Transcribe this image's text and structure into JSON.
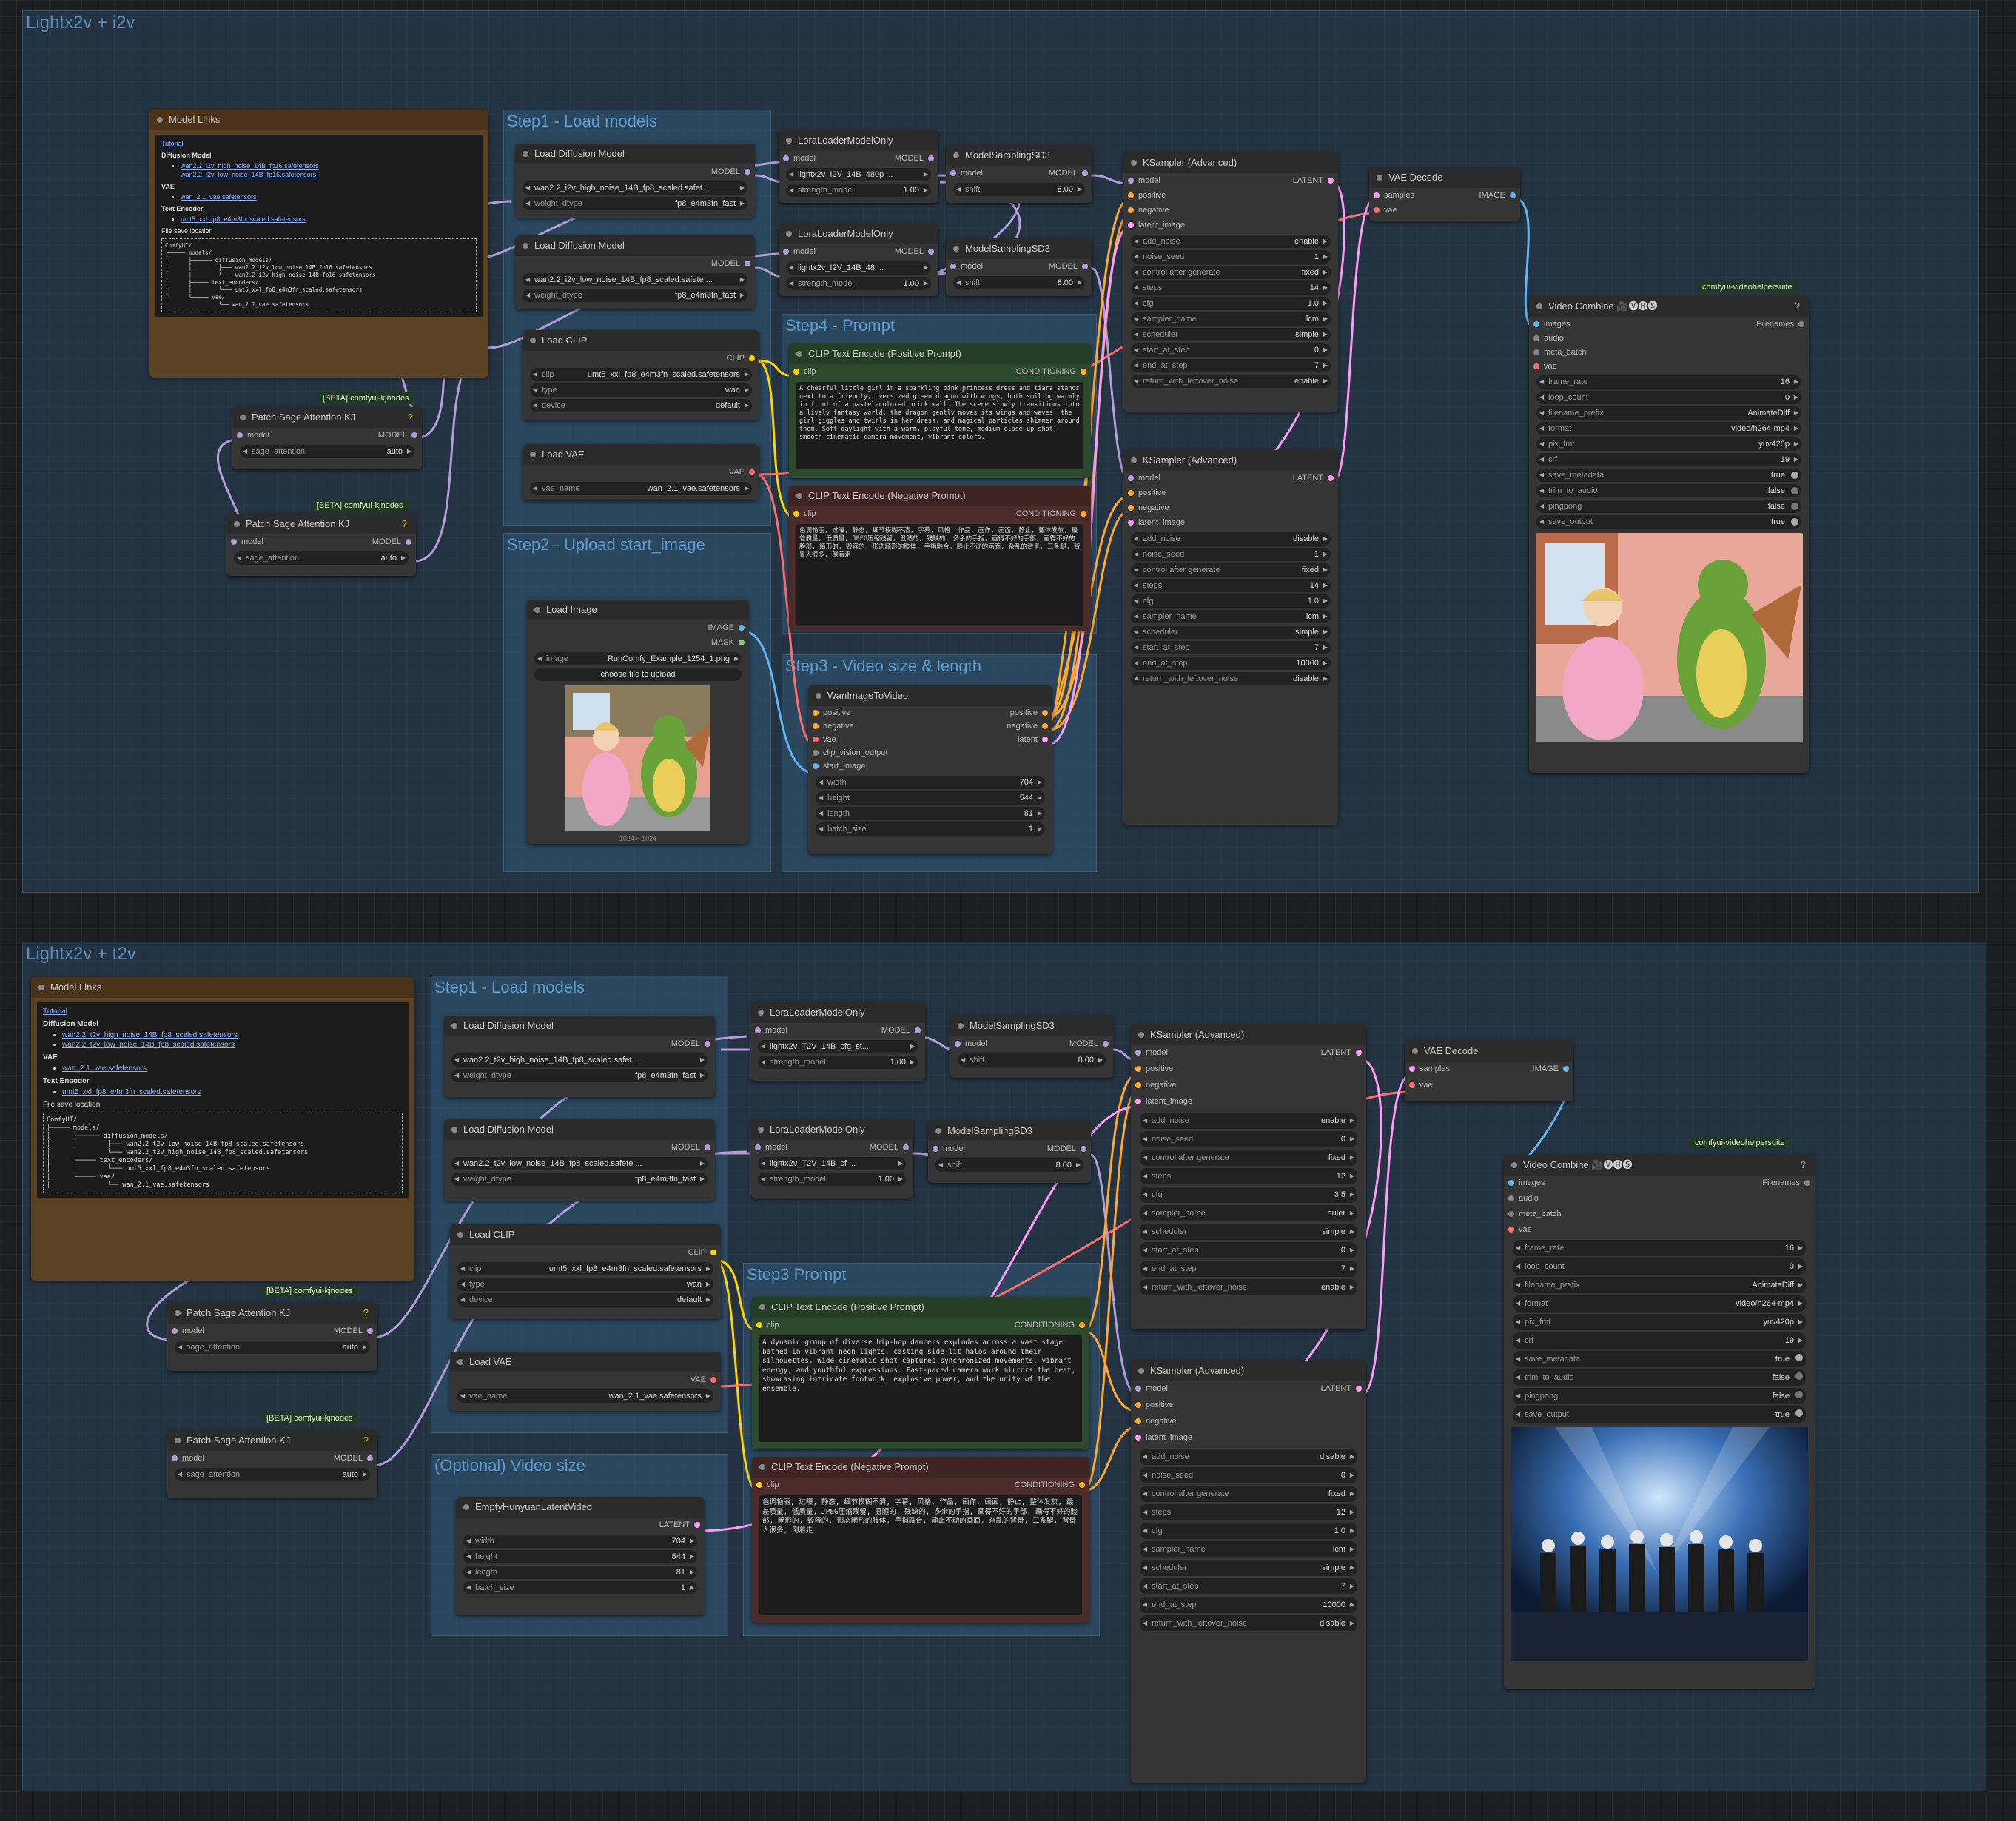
{
  "colors": {
    "model": "#b39ddb",
    "clip": "#ffd500",
    "vae": "#ff6e6e",
    "conditioning": "#ffa931",
    "latent": "#ff9cf9",
    "image": "#64b5f6",
    "mask": "#81c784"
  },
  "top": {
    "group_title": "Lightx2v + i2v",
    "step1": "Step1 - Load models",
    "step2": "Step2 - Upload start_image",
    "step3": "Step3 - Video size & length",
    "step4": "Step4 - Prompt",
    "links": {
      "title": "Model Links",
      "tutorial": "Tutorial",
      "diffusion_h": "Diffusion Model",
      "d1": "wan2.2_i2v_high_noise_14B_fp16.safetensors",
      "d2": "wan2.2_i2v_low_noise_14B_fp16.safetensors",
      "vae_h": "VAE",
      "v1": "wan_2.1_vae.safetensors",
      "te_h": "Text Encoder",
      "t1": "umt5_xxl_fp8_e4m3fn_scaled.safetensors",
      "save_h": "File save location",
      "tree": "ComfyUI/\n├───── models/\n│      ├────── diffusion_models/\n│      │        ├─── wan2.2_i2v_low_noise_14B_fp16.safetensors\n│      │        └─── wan2.2_i2v_high_noise_14B_fp16.safetensors\n│      ├───── text_encoders/\n│      │        └─── umt5_xxl_fp8_e4m3fn_scaled.safetensors\n│      └───── vae/\n│               └── wan_2.1_vae.safetensors"
    },
    "sage1": {
      "badge": "[BETA] comfyui-kjnodes",
      "title": "Patch Sage Attention KJ",
      "in": "model",
      "out": "MODEL",
      "w": "sage_attention",
      "v": "auto"
    },
    "sage2": {
      "badge": "[BETA] comfyui-kjnodes",
      "title": "Patch Sage Attention KJ",
      "in": "model",
      "out": "MODEL",
      "w": "sage_attention",
      "v": "auto"
    },
    "ldm1": {
      "title": "Load Diffusion Model",
      "out": "MODEL",
      "w1": "wan2.2_i2v_high_noise_14B_fp8_scaled.safet ...",
      "w2l": "weight_dtype",
      "w2v": "fp8_e4m3fn_fast"
    },
    "ldm2": {
      "title": "Load Diffusion Model",
      "out": "MODEL",
      "w1": "wan2.2_i2v_low_noise_14B_fp8_scaled.safete ...",
      "w2l": "weight_dtype",
      "w2v": "fp8_e4m3fn_fast"
    },
    "clip": {
      "title": "Load CLIP",
      "out": "CLIP",
      "w1l": "clip",
      "w1v": "umt5_xxl_fp8_e4m3fn_scaled.safetensors",
      "w2l": "type",
      "w2v": "wan",
      "w3l": "device",
      "w3v": "default"
    },
    "vae": {
      "title": "Load VAE",
      "out": "VAE",
      "wl": "vae_name",
      "wv": "wan_2.1_vae.safetensors"
    },
    "img": {
      "title": "Load Image",
      "o1": "IMAGE",
      "o2": "MASK",
      "wl": "image",
      "wv": "RunComfy_Example_1254_1.png",
      "btn": "choose file to upload",
      "cap": "1024 × 1024"
    },
    "lora1": {
      "title": "LoraLoaderModelOnly",
      "in": "model",
      "out": "MODEL",
      "w1": "lightx2v_I2V_14B_480p ...",
      "w2l": "strength_model",
      "w2v": "1.00"
    },
    "lora2": {
      "title": "LoraLoaderModelOnly",
      "in": "model",
      "out": "MODEL",
      "w1": "lightx2v_I2V_14B_48 ...",
      "w2l": "strength_model",
      "w2v": "1.00"
    },
    "ms1": {
      "title": "ModelSamplingSD3",
      "in": "model",
      "out": "MODEL",
      "wl": "shift",
      "wv": "8.00"
    },
    "ms2": {
      "title": "ModelSamplingSD3",
      "in": "model",
      "out": "MODEL",
      "wl": "shift",
      "wv": "8.00"
    },
    "pos": {
      "title": "CLIP Text Encode (Positive Prompt)",
      "in": "clip",
      "out": "CONDITIONING",
      "text": "A cheerful little girl in a sparkling pink princess dress and tiara stands next to a friendly, oversized green dragon with wings, both smiling warmly in front of a pastel-colored brick wall. The scene slowly transitions into a lively fantasy world: the dragon gently moves its wings and waves, the girl giggles and twirls in her dress, and magical particles shimmer around them. Soft daylight with a warm, playful tone, medium close-up shot, smooth cinematic camera movement, vibrant colors."
    },
    "neg": {
      "title": "CLIP Text Encode (Negative Prompt)",
      "in": "clip",
      "out": "CONDITIONING",
      "text": "色调艳丽, 过曝, 静态, 细节模糊不清, 字幕, 风格, 作品, 画作, 画面, 静止, 整体发灰, 最差质量, 低质量, JPEG压缩残留, 丑陋的, 残缺的, 多余的手指, 画得不好的手部, 画得不好的脸部, 畸形的, 毁容的, 形态畸形的肢体, 手指融合, 静止不动的画面, 杂乱的背景, 三条腿, 背景人很多, 倒着走"
    },
    "wan": {
      "title": "WanImageToVideo",
      "i1": "positive",
      "i2": "negative",
      "i3": "vae",
      "i4": "clip_vision_output",
      "i5": "start_image",
      "o1": "positive",
      "o2": "negative",
      "o3": "latent",
      "w": [
        [
          "width",
          "704"
        ],
        [
          "height",
          "544"
        ],
        [
          "length",
          "81"
        ],
        [
          "batch_size",
          "1"
        ]
      ]
    },
    "ks1": {
      "title": "KSampler (Advanced)",
      "ins": [
        "model",
        "positive",
        "negative",
        "latent_image"
      ],
      "out": "LATENT",
      "w": [
        [
          "add_noise",
          "enable"
        ],
        [
          "noise_seed",
          "1"
        ],
        [
          "control after generate",
          "fixed"
        ],
        [
          "steps",
          "14"
        ],
        [
          "cfg",
          "1.0"
        ],
        [
          "sampler_name",
          "lcm"
        ],
        [
          "scheduler",
          "simple"
        ],
        [
          "start_at_step",
          "0"
        ],
        [
          "end_at_step",
          "7"
        ],
        [
          "return_with_leftover_noise",
          "enable"
        ]
      ]
    },
    "ks2": {
      "title": "KSampler (Advanced)",
      "ins": [
        "model",
        "positive",
        "negative",
        "latent_image"
      ],
      "out": "LATENT",
      "w": [
        [
          "add_noise",
          "disable"
        ],
        [
          "noise_seed",
          "1"
        ],
        [
          "control after generate",
          "fixed"
        ],
        [
          "steps",
          "14"
        ],
        [
          "cfg",
          "1.0"
        ],
        [
          "sampler_name",
          "lcm"
        ],
        [
          "scheduler",
          "simple"
        ],
        [
          "start_at_step",
          "7"
        ],
        [
          "end_at_step",
          "10000"
        ],
        [
          "return_with_leftover_noise",
          "disable"
        ]
      ]
    },
    "vaed": {
      "title": "VAE Decode",
      "i1": "samples",
      "i2": "vae",
      "out": "IMAGE"
    },
    "vc": {
      "badge": "comfyui-videohelpersuite",
      "title": "Video Combine 🎥🅥🅗🅢",
      "ins": [
        "images",
        "audio",
        "meta_batch",
        "vae"
      ],
      "out": "Filenames",
      "w": [
        [
          "frame_rate",
          "16"
        ],
        [
          "loop_count",
          "0"
        ],
        [
          "filename_prefix",
          "AnimateDiff"
        ],
        [
          "format",
          "video/h264-mp4"
        ],
        [
          "pix_fmt",
          "yuv420p"
        ],
        [
          "crf",
          "19"
        ]
      ],
      "t": [
        [
          "save_metadata",
          "true"
        ],
        [
          "trim_to_audio",
          "false"
        ],
        [
          "pingpong",
          "false"
        ],
        [
          "save_output",
          "true"
        ]
      ]
    }
  },
  "bottom": {
    "group_title": "Lightx2v + t2v",
    "step1": "Step1 - Load models",
    "step3": "Step3 Prompt",
    "opt": "(Optional) Video size",
    "links": {
      "title": "Model Links",
      "tutorial": "Tutorial",
      "diffusion_h": "Diffusion Model",
      "d1": "wan2.2_t2v_high_noise_14B_fp8_scaled.safetensors",
      "d2": "wan2.2_t2v_low_noise_14B_fp8_scaled.safetensors",
      "vae_h": "VAE",
      "v1": "wan_2.1_vae.safetensors",
      "te_h": "Text Encoder",
      "t1": "umt5_xxl_fp8_e4m3fn_scaled.safetensors",
      "save_h": "File save location",
      "tree": "ComfyUI/\n├───── models/\n│      ├────── diffusion_models/\n│      │        ├─── wan2.2_t2v_low_noise_14B_fp8_scaled.safetensors\n│      │        └─── wan2.2_t2v_high_noise_14B_fp8_scaled.safetensors\n│      ├───── text_encoders/\n│      │        └─── umt5_xxl_fp8_e4m3fn_scaled.safetensors\n│      └───── vae/\n│               └── wan_2.1_vae.safetensors"
    },
    "sage1": {
      "badge": "[BETA] comfyui-kjnodes",
      "title": "Patch Sage Attention KJ",
      "in": "model",
      "out": "MODEL",
      "w": "sage_attention",
      "v": "auto"
    },
    "sage2": {
      "badge": "[BETA] comfyui-kjnodes",
      "title": "Patch Sage Attention KJ",
      "in": "model",
      "out": "MODEL",
      "w": "sage_attention",
      "v": "auto"
    },
    "ldm1": {
      "title": "Load Diffusion Model",
      "out": "MODEL",
      "w1": "wan2.2_t2v_high_noise_14B_fp8_scaled.safet ...",
      "w2l": "weight_dtype",
      "w2v": "fp8_e4m3fn_fast"
    },
    "ldm2": {
      "title": "Load Diffusion Model",
      "out": "MODEL",
      "w1": "wan2.2_t2v_low_noise_14B_fp8_scaled.safete ...",
      "w2l": "weight_dtype",
      "w2v": "fp8_e4m3fn_fast"
    },
    "clip": {
      "title": "Load CLIP",
      "out": "CLIP",
      "w1l": "clip",
      "w1v": "umt5_xxl_fp8_e4m3fn_scaled.safetensors",
      "w2l": "type",
      "w2v": "wan",
      "w3l": "device",
      "w3v": "default"
    },
    "vae": {
      "title": "Load VAE",
      "out": "VAE",
      "wl": "vae_name",
      "wv": "wan_2.1_vae.safetensors"
    },
    "lora1": {
      "title": "LoraLoaderModelOnly",
      "in": "model",
      "out": "MODEL",
      "w1": "lightx2v_T2V_14B_cfg_st...",
      "w2l": "strength_model",
      "w2v": "1.00"
    },
    "lora2": {
      "title": "LoraLoaderModelOnly",
      "in": "model",
      "out": "MODEL",
      "w1": "lightx2v_T2V_14B_cf ...",
      "w2l": "strength_model",
      "w2v": "1.00"
    },
    "ms1": {
      "title": "ModelSamplingSD3",
      "in": "model",
      "out": "MODEL",
      "wl": "shift",
      "wv": "8.00"
    },
    "ms2": {
      "title": "ModelSamplingSD3",
      "in": "model",
      "out": "MODEL",
      "wl": "shift",
      "wv": "8.00"
    },
    "pos": {
      "title": "CLIP Text Encode (Positive Prompt)",
      "in": "clip",
      "out": "CONDITIONING",
      "text": "A dynamic group of diverse hip-hop dancers explodes across a vast stage bathed in vibrant neon lights, casting side-lit halos around their silhouettes. Wide cinematic shot captures synchronized movements, vibrant energy, and youthful expressions. Fast-paced camera work mirrors the beat, showcasing intricate footwork, explosive power, and the unity of the ensemble."
    },
    "neg": {
      "title": "CLIP Text Encode (Negative Prompt)",
      "in": "clip",
      "out": "CONDITIONING",
      "text": "色调艳丽, 过曝, 静态, 细节模糊不清, 字幕, 风格, 作品, 画作, 画面, 静止, 整体发灰, 最差质量, 低质量, JPEG压缩残留, 丑陋的, 残缺的, 多余的手指, 画得不好的手部, 画得不好的脸部, 畸形的, 毁容的, 形态畸形的肢体, 手指融合, 静止不动的画面, 杂乱的背景, 三条腿, 背景人很多, 倒着走"
    },
    "empty": {
      "title": "EmptyHunyuanLatentVideo",
      "out": "LATENT",
      "w": [
        [
          "width",
          "704"
        ],
        [
          "height",
          "544"
        ],
        [
          "length",
          "81"
        ],
        [
          "batch_size",
          "1"
        ]
      ]
    },
    "ks1": {
      "title": "KSampler (Advanced)",
      "ins": [
        "model",
        "positive",
        "negative",
        "latent_image"
      ],
      "out": "LATENT",
      "w": [
        [
          "add_noise",
          "enable"
        ],
        [
          "noise_seed",
          "0"
        ],
        [
          "control after generate",
          "fixed"
        ],
        [
          "steps",
          "12"
        ],
        [
          "cfg",
          "3.5"
        ],
        [
          "sampler_name",
          "euler"
        ],
        [
          "scheduler",
          "simple"
        ],
        [
          "start_at_step",
          "0"
        ],
        [
          "end_at_step",
          "7"
        ],
        [
          "return_with_leftover_noise",
          "enable"
        ]
      ]
    },
    "ks2": {
      "title": "KSampler (Advanced)",
      "ins": [
        "model",
        "positive",
        "negative",
        "latent_image"
      ],
      "out": "LATENT",
      "w": [
        [
          "add_noise",
          "disable"
        ],
        [
          "noise_seed",
          "0"
        ],
        [
          "control after generate",
          "fixed"
        ],
        [
          "steps",
          "12"
        ],
        [
          "cfg",
          "1.0"
        ],
        [
          "sampler_name",
          "lcm"
        ],
        [
          "scheduler",
          "simple"
        ],
        [
          "start_at_step",
          "7"
        ],
        [
          "end_at_step",
          "10000"
        ],
        [
          "return_with_leftover_noise",
          "disable"
        ]
      ]
    },
    "vaed": {
      "title": "VAE Decode",
      "i1": "samples",
      "i2": "vae",
      "out": "IMAGE"
    },
    "vc": {
      "badge": "comfyui-videohelpersuite",
      "title": "Video Combine 🎥🅥🅗🅢",
      "ins": [
        "images",
        "audio",
        "meta_batch",
        "vae"
      ],
      "out": "Filenames",
      "w": [
        [
          "frame_rate",
          "16"
        ],
        [
          "loop_count",
          "0"
        ],
        [
          "filename_prefix",
          "AnimateDiff"
        ],
        [
          "format",
          "video/h264-mp4"
        ],
        [
          "pix_fmt",
          "yuv420p"
        ],
        [
          "crf",
          "19"
        ]
      ],
      "t": [
        [
          "save_metadata",
          "true"
        ],
        [
          "trim_to_audio",
          "false"
        ],
        [
          "pingpong",
          "false"
        ],
        [
          "save_output",
          "true"
        ]
      ]
    }
  }
}
